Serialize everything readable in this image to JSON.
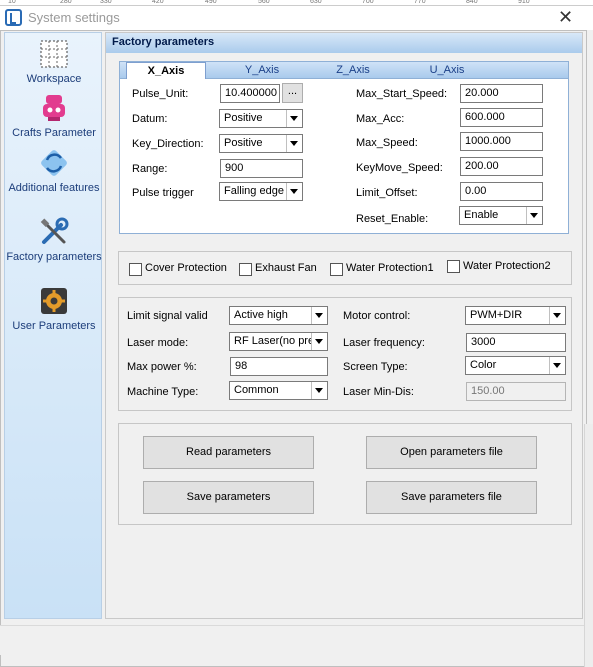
{
  "ruler": [
    "10",
    "280",
    "330",
    "420",
    "490",
    "560",
    "630",
    "700",
    "770",
    "840",
    "910"
  ],
  "window": {
    "title": "System settings",
    "close_glyph": "✕"
  },
  "sidebar": {
    "items": [
      {
        "label": "Workspace",
        "icon": "workspace-grid-icon"
      },
      {
        "label": "Crafts Parameter",
        "icon": "crafts-robot-icon"
      },
      {
        "label": "Additional features",
        "icon": "additional-features-icon"
      },
      {
        "label": "Factory parameters",
        "icon": "factory-tools-icon"
      },
      {
        "label": "User Parameters",
        "icon": "user-gear-icon"
      }
    ]
  },
  "content": {
    "header": "Factory parameters",
    "tabs": [
      "X_Axis",
      "Y_Axis",
      "Z_Axis",
      "U_Axis"
    ],
    "active_tab": "X_Axis",
    "axis_left": [
      {
        "label": "Pulse_Unit:",
        "value": "10.400000",
        "kind": "input-dots"
      },
      {
        "label": "Datum:",
        "value": "Positive",
        "kind": "select"
      },
      {
        "label": "Key_Direction:",
        "value": "Positive",
        "kind": "select"
      },
      {
        "label": "Range:",
        "value": "900",
        "kind": "input"
      },
      {
        "label": "Pulse trigger",
        "value": "Falling edge",
        "kind": "select"
      }
    ],
    "dots_label": "...",
    "axis_right": [
      {
        "label": "Max_Start_Speed:",
        "value": "20.000",
        "kind": "input"
      },
      {
        "label": "Max_Acc:",
        "value": "600.000",
        "kind": "input"
      },
      {
        "label": "Max_Speed:",
        "value": "1000.000",
        "kind": "input"
      },
      {
        "label": "KeyMove_Speed:",
        "value": "200.00",
        "kind": "input"
      },
      {
        "label": "Limit_Offset:",
        "value": "0.00",
        "kind": "input"
      },
      {
        "label": "Reset_Enable:",
        "value": "Enable",
        "kind": "select"
      }
    ],
    "protections": [
      "Cover Protection",
      "Exhaust Fan",
      "Water Protection1",
      "Water Protection2"
    ],
    "laser_left": [
      {
        "label": "Limit signal valid",
        "value": "Active high",
        "kind": "select"
      },
      {
        "label": "Laser mode:",
        "value": "RF Laser(no pre",
        "kind": "select"
      },
      {
        "label": "Max power %:",
        "value": "98",
        "kind": "input"
      },
      {
        "label": "Machine Type:",
        "value": "Common",
        "kind": "select"
      }
    ],
    "laser_right": [
      {
        "label": "Motor control:",
        "value": "PWM+DIR",
        "kind": "select"
      },
      {
        "label": "Laser frequency:",
        "value": "3000",
        "kind": "input"
      },
      {
        "label": "Screen Type:",
        "value": "Color",
        "kind": "select"
      },
      {
        "label": "Laser Min-Dis:",
        "value": "150.00",
        "kind": "input-disabled"
      }
    ],
    "buttons": {
      "read": "Read parameters",
      "open_file": "Open parameters file",
      "save": "Save parameters",
      "save_file": "Save parameters file"
    }
  }
}
